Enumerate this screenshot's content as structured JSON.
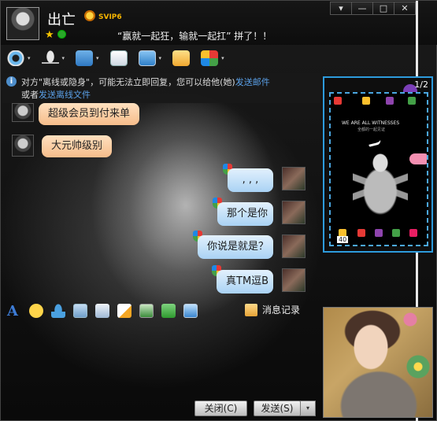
{
  "header": {
    "nickname": "出亡",
    "vip_badge": "SVIP6",
    "signature": "“赢就一起狂，输就一起扛” 拼了！！"
  },
  "window_controls": {
    "menu": "▾",
    "minimize": "—",
    "maximize": "□",
    "close": "✕"
  },
  "toolbar": {
    "items": [
      "camera-icon",
      "microphone-icon",
      "file-transfer-icon",
      "add-contact-icon",
      "remote-screen-icon",
      "share-screen-icon",
      "apps-grid-icon"
    ],
    "dropdown_glyph": "▾"
  },
  "notice": {
    "line1_prefix": "对方\"离线或隐身\"，可能无法立即回复，您可以给他(她)",
    "line1_link": "发送邮件",
    "line2_prefix": "或者",
    "line2_link": "发送离线文件"
  },
  "messages": [
    {
      "side": "left",
      "text": "超级会员到付来单"
    },
    {
      "side": "left",
      "text": "大元帅级别"
    },
    {
      "side": "right",
      "text": ", , ,"
    },
    {
      "side": "right",
      "text": "那个是你"
    },
    {
      "side": "right",
      "text": "你说是就是？"
    },
    {
      "side": "right",
      "text": "真TM逗B"
    }
  ],
  "input_toolbar": {
    "font_label": "A",
    "history_label": "消息记录"
  },
  "buttons": {
    "close_label": "关闭(C)",
    "send_label": "发送(S)",
    "dropdown_glyph": "▾"
  },
  "show_panel": {
    "counter": "1/2",
    "line1": "WE ARE ALL WITNESSES",
    "line2": "全都的一起见证",
    "badge_number": "40"
  },
  "colors": {
    "link": "#5aa0e8",
    "left_bubble": "#f6bd8b",
    "right_bubble": "#a9d2f4",
    "panel_border": "#2d9bdc"
  }
}
